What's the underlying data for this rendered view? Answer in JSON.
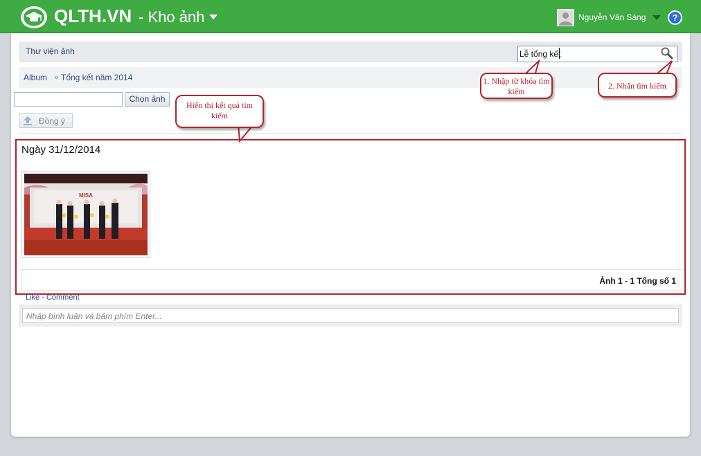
{
  "header": {
    "brand": "QLTH.VN",
    "section": "- Kho ảnh",
    "username": "Nguyễn Văn Sáng",
    "help_label": "?"
  },
  "library": {
    "title": "Thư viện ảnh",
    "search": {
      "value": "Lễ tổng kết"
    }
  },
  "breadcrumb": {
    "album": "Album",
    "separator": "»",
    "current": "Tổng kết năm 2014"
  },
  "upload": {
    "choose_label": "Chọn ảnh",
    "agree_label": "Đồng ý"
  },
  "results": {
    "date_title": "Ngày 31/12/2014",
    "photo": {
      "image_text": "MISA"
    },
    "pager": "Ảnh 1 - 1 Tổng số 1"
  },
  "social": {
    "like_comment": "Like - Comment",
    "comment_placeholder": "Nhập bình luận và bấm phím Enter..."
  },
  "callouts": {
    "c1": "1. Nhập từ khóa tìm kiếm",
    "c2": "2. Nhấn tìm kiếm",
    "c3": "Hiển thị kết quả tìm kiếm"
  },
  "colors": {
    "header_green": "#3eab43",
    "callout_red": "#b5222c",
    "link_blue": "#2c4e86"
  }
}
